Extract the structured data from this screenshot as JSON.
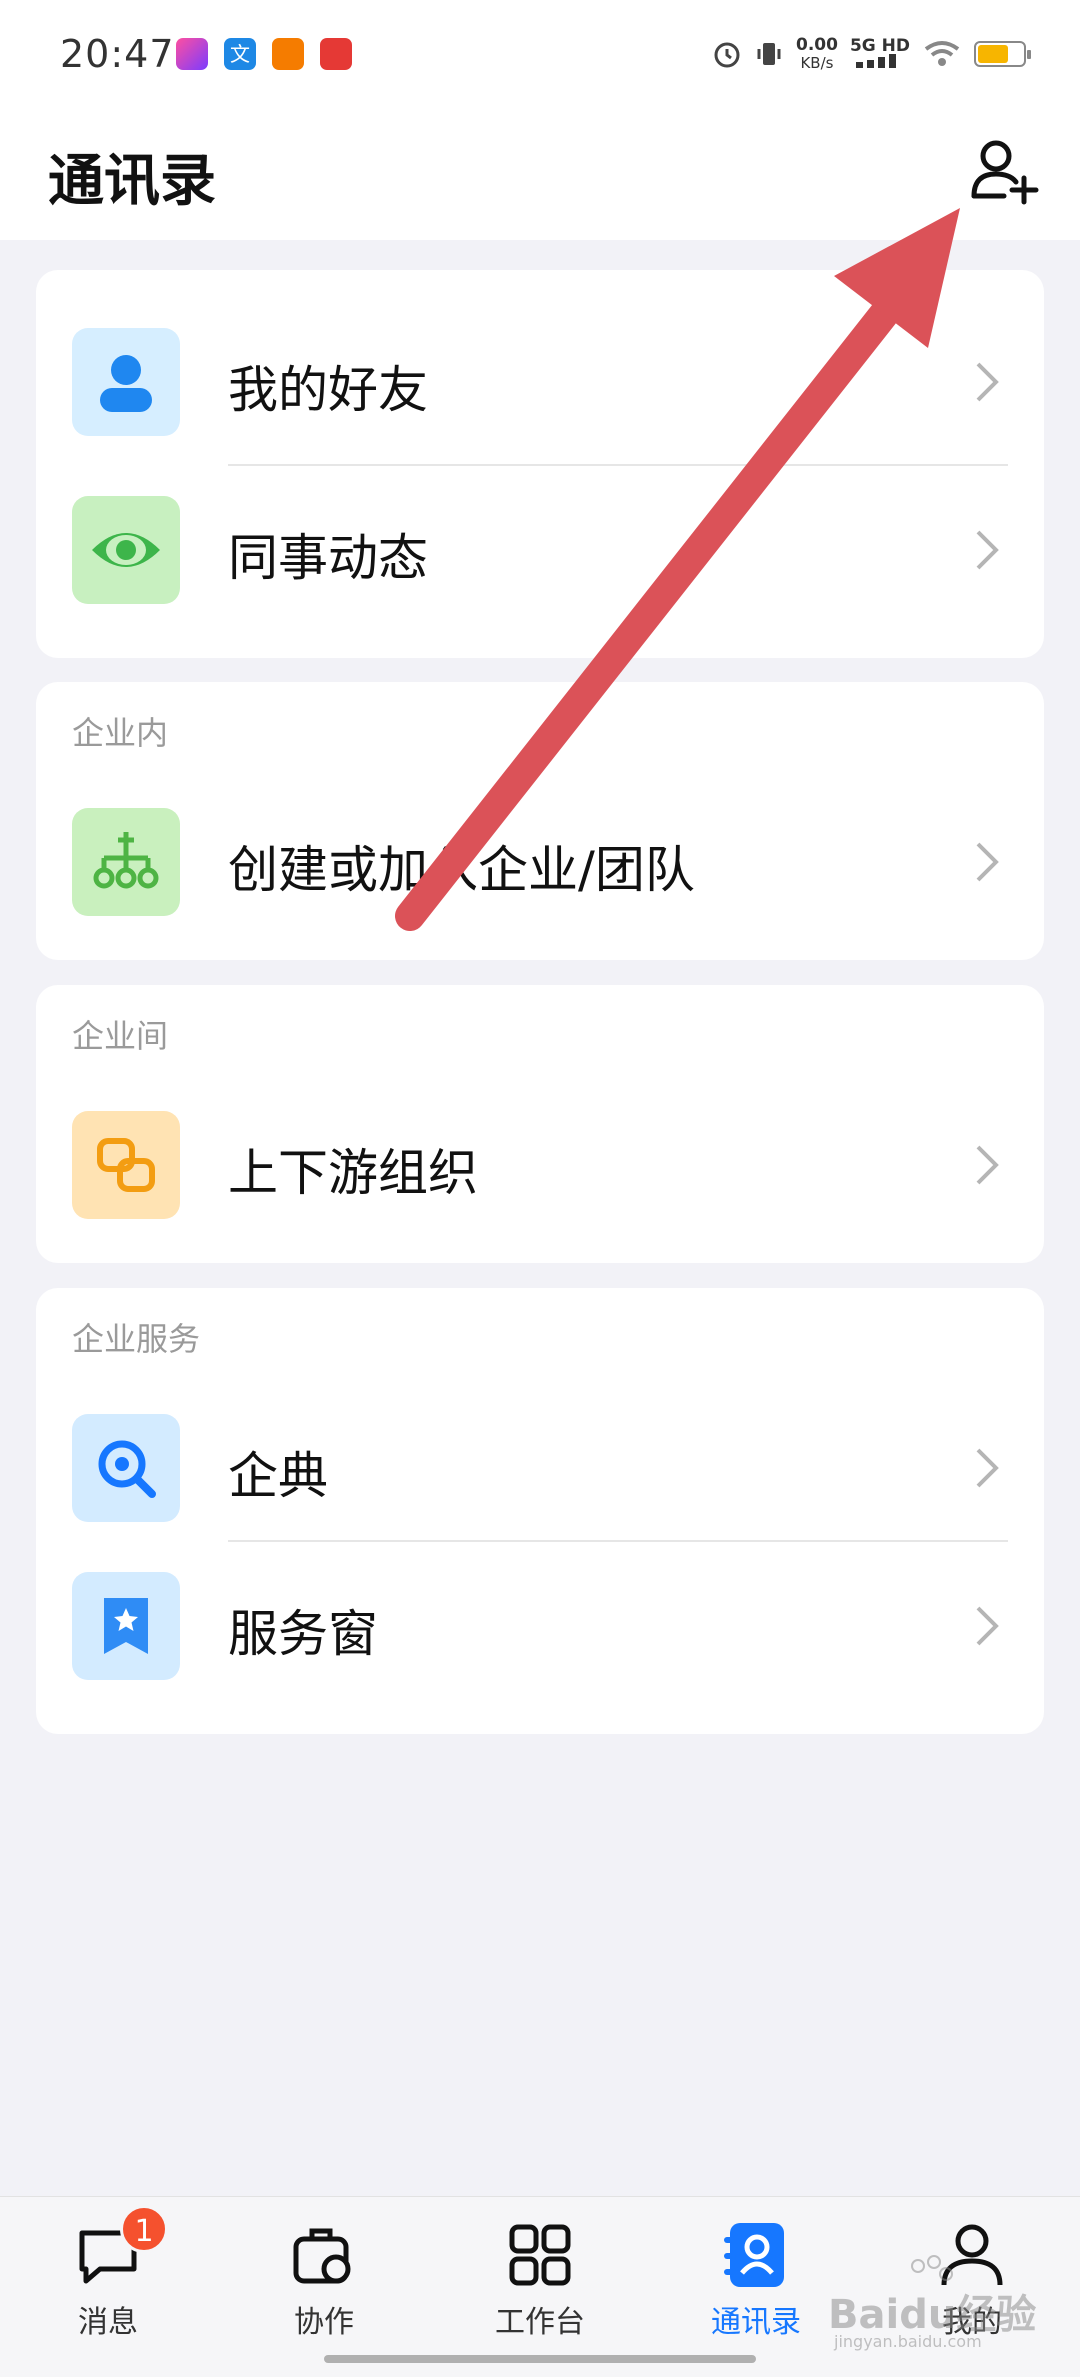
{
  "status_bar": {
    "time": "20:47",
    "net_speed_value": "0.00",
    "net_speed_unit": "KB/s",
    "network": "5G HD",
    "battery_color": "#f7b500",
    "notification_icons": [
      "video-app-icon",
      "translate-app-icon",
      "key-app-icon",
      "search-app-icon"
    ]
  },
  "header": {
    "title": "通讯录",
    "action_icon": "add-contact-icon"
  },
  "groups": [
    {
      "title": "",
      "items": [
        {
          "label": "我的好友",
          "icon": "friend-icon",
          "icon_bg": "#d6eeff",
          "icon_color": "#1f87f0"
        },
        {
          "label": "同事动态",
          "icon": "eye-icon",
          "icon_bg": "#c8f0c0",
          "icon_color": "#3db54a"
        }
      ]
    },
    {
      "title": "企业内",
      "items": [
        {
          "label": "创建或加入企业/团队",
          "icon": "org-tree-icon",
          "icon_bg": "#c9f0be",
          "icon_color": "#4eb444"
        }
      ]
    },
    {
      "title": "企业间",
      "items": [
        {
          "label": "上下游组织",
          "icon": "link-icon",
          "icon_bg": "#ffe3b3",
          "icon_color": "#f39d12"
        }
      ]
    },
    {
      "title": "企业服务",
      "items": [
        {
          "label": "企典",
          "icon": "search-icon",
          "icon_bg": "#d3ebff",
          "icon_color": "#1677ff"
        },
        {
          "label": "服务窗",
          "icon": "bookmark-icon",
          "icon_bg": "#d3ebff",
          "icon_color": "#2f8cf5"
        }
      ]
    }
  ],
  "tabbar": {
    "active_color": "#1677ff",
    "tabs": [
      {
        "label": "消息",
        "icon": "message-icon",
        "badge": "1",
        "active": false
      },
      {
        "label": "协作",
        "icon": "collaborate-icon",
        "active": false
      },
      {
        "label": "工作台",
        "icon": "grid-icon",
        "active": false
      },
      {
        "label": "通讯录",
        "icon": "contacts-icon",
        "active": true
      },
      {
        "label": "我的",
        "icon": "profile-icon",
        "active": false
      }
    ]
  },
  "annotation": {
    "type": "arrow",
    "color": "#db5258"
  },
  "watermark": {
    "text": "Baidu经验",
    "subtext": "jingyan.baidu.com"
  }
}
